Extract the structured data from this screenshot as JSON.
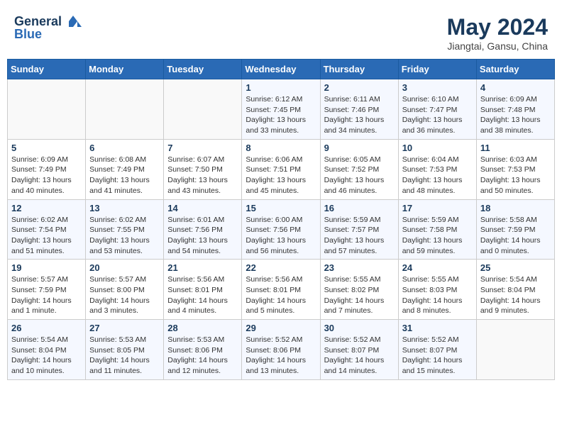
{
  "header": {
    "logo_line1": "General",
    "logo_line2": "Blue",
    "month": "May 2024",
    "location": "Jiangtai, Gansu, China"
  },
  "weekdays": [
    "Sunday",
    "Monday",
    "Tuesday",
    "Wednesday",
    "Thursday",
    "Friday",
    "Saturday"
  ],
  "weeks": [
    [
      {
        "day": "",
        "text": ""
      },
      {
        "day": "",
        "text": ""
      },
      {
        "day": "",
        "text": ""
      },
      {
        "day": "1",
        "text": "Sunrise: 6:12 AM\nSunset: 7:45 PM\nDaylight: 13 hours\nand 33 minutes."
      },
      {
        "day": "2",
        "text": "Sunrise: 6:11 AM\nSunset: 7:46 PM\nDaylight: 13 hours\nand 34 minutes."
      },
      {
        "day": "3",
        "text": "Sunrise: 6:10 AM\nSunset: 7:47 PM\nDaylight: 13 hours\nand 36 minutes."
      },
      {
        "day": "4",
        "text": "Sunrise: 6:09 AM\nSunset: 7:48 PM\nDaylight: 13 hours\nand 38 minutes."
      }
    ],
    [
      {
        "day": "5",
        "text": "Sunrise: 6:09 AM\nSunset: 7:49 PM\nDaylight: 13 hours\nand 40 minutes."
      },
      {
        "day": "6",
        "text": "Sunrise: 6:08 AM\nSunset: 7:49 PM\nDaylight: 13 hours\nand 41 minutes."
      },
      {
        "day": "7",
        "text": "Sunrise: 6:07 AM\nSunset: 7:50 PM\nDaylight: 13 hours\nand 43 minutes."
      },
      {
        "day": "8",
        "text": "Sunrise: 6:06 AM\nSunset: 7:51 PM\nDaylight: 13 hours\nand 45 minutes."
      },
      {
        "day": "9",
        "text": "Sunrise: 6:05 AM\nSunset: 7:52 PM\nDaylight: 13 hours\nand 46 minutes."
      },
      {
        "day": "10",
        "text": "Sunrise: 6:04 AM\nSunset: 7:53 PM\nDaylight: 13 hours\nand 48 minutes."
      },
      {
        "day": "11",
        "text": "Sunrise: 6:03 AM\nSunset: 7:53 PM\nDaylight: 13 hours\nand 50 minutes."
      }
    ],
    [
      {
        "day": "12",
        "text": "Sunrise: 6:02 AM\nSunset: 7:54 PM\nDaylight: 13 hours\nand 51 minutes."
      },
      {
        "day": "13",
        "text": "Sunrise: 6:02 AM\nSunset: 7:55 PM\nDaylight: 13 hours\nand 53 minutes."
      },
      {
        "day": "14",
        "text": "Sunrise: 6:01 AM\nSunset: 7:56 PM\nDaylight: 13 hours\nand 54 minutes."
      },
      {
        "day": "15",
        "text": "Sunrise: 6:00 AM\nSunset: 7:56 PM\nDaylight: 13 hours\nand 56 minutes."
      },
      {
        "day": "16",
        "text": "Sunrise: 5:59 AM\nSunset: 7:57 PM\nDaylight: 13 hours\nand 57 minutes."
      },
      {
        "day": "17",
        "text": "Sunrise: 5:59 AM\nSunset: 7:58 PM\nDaylight: 13 hours\nand 59 minutes."
      },
      {
        "day": "18",
        "text": "Sunrise: 5:58 AM\nSunset: 7:59 PM\nDaylight: 14 hours\nand 0 minutes."
      }
    ],
    [
      {
        "day": "19",
        "text": "Sunrise: 5:57 AM\nSunset: 7:59 PM\nDaylight: 14 hours\nand 1 minute."
      },
      {
        "day": "20",
        "text": "Sunrise: 5:57 AM\nSunset: 8:00 PM\nDaylight: 14 hours\nand 3 minutes."
      },
      {
        "day": "21",
        "text": "Sunrise: 5:56 AM\nSunset: 8:01 PM\nDaylight: 14 hours\nand 4 minutes."
      },
      {
        "day": "22",
        "text": "Sunrise: 5:56 AM\nSunset: 8:01 PM\nDaylight: 14 hours\nand 5 minutes."
      },
      {
        "day": "23",
        "text": "Sunrise: 5:55 AM\nSunset: 8:02 PM\nDaylight: 14 hours\nand 7 minutes."
      },
      {
        "day": "24",
        "text": "Sunrise: 5:55 AM\nSunset: 8:03 PM\nDaylight: 14 hours\nand 8 minutes."
      },
      {
        "day": "25",
        "text": "Sunrise: 5:54 AM\nSunset: 8:04 PM\nDaylight: 14 hours\nand 9 minutes."
      }
    ],
    [
      {
        "day": "26",
        "text": "Sunrise: 5:54 AM\nSunset: 8:04 PM\nDaylight: 14 hours\nand 10 minutes."
      },
      {
        "day": "27",
        "text": "Sunrise: 5:53 AM\nSunset: 8:05 PM\nDaylight: 14 hours\nand 11 minutes."
      },
      {
        "day": "28",
        "text": "Sunrise: 5:53 AM\nSunset: 8:06 PM\nDaylight: 14 hours\nand 12 minutes."
      },
      {
        "day": "29",
        "text": "Sunrise: 5:52 AM\nSunset: 8:06 PM\nDaylight: 14 hours\nand 13 minutes."
      },
      {
        "day": "30",
        "text": "Sunrise: 5:52 AM\nSunset: 8:07 PM\nDaylight: 14 hours\nand 14 minutes."
      },
      {
        "day": "31",
        "text": "Sunrise: 5:52 AM\nSunset: 8:07 PM\nDaylight: 14 hours\nand 15 minutes."
      },
      {
        "day": "",
        "text": ""
      }
    ]
  ]
}
